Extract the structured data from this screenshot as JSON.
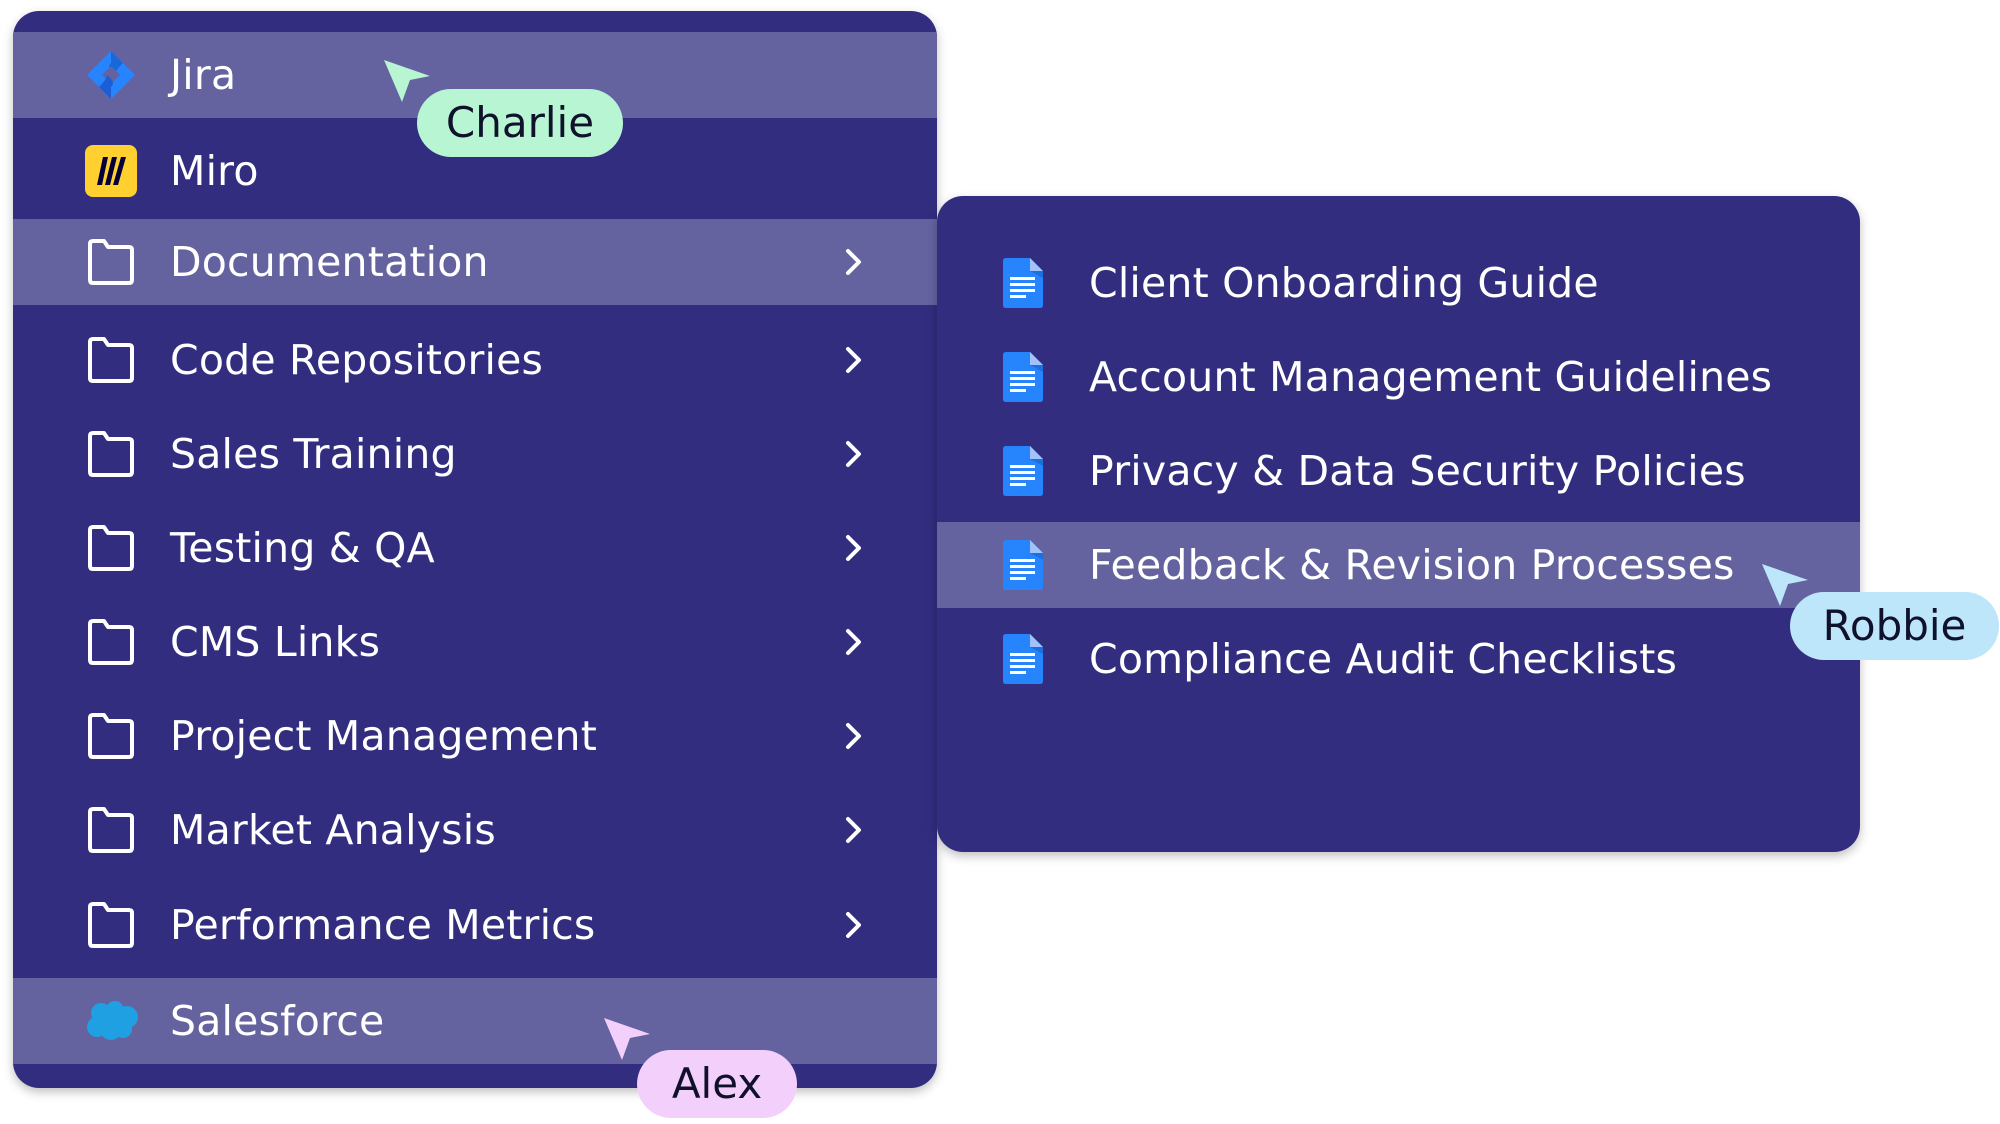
{
  "main_menu": {
    "items": [
      {
        "label": "Jira",
        "icon": "jira-logo-icon",
        "highlighted": true,
        "has_submenu": false
      },
      {
        "label": "Miro",
        "icon": "miro-logo-icon",
        "highlighted": false,
        "has_submenu": false
      },
      {
        "label": "Documentation",
        "icon": "folder-icon",
        "highlighted": true,
        "has_submenu": true
      },
      {
        "label": "Code Repositories",
        "icon": "folder-icon",
        "highlighted": false,
        "has_submenu": true
      },
      {
        "label": "Sales Training",
        "icon": "folder-icon",
        "highlighted": false,
        "has_submenu": true
      },
      {
        "label": "Testing & QA",
        "icon": "folder-icon",
        "highlighted": false,
        "has_submenu": true
      },
      {
        "label": "CMS Links",
        "icon": "folder-icon",
        "highlighted": false,
        "has_submenu": true
      },
      {
        "label": "Project Management",
        "icon": "folder-icon",
        "highlighted": false,
        "has_submenu": true
      },
      {
        "label": "Market Analysis",
        "icon": "folder-icon",
        "highlighted": false,
        "has_submenu": true
      },
      {
        "label": "Performance Metrics",
        "icon": "folder-icon",
        "highlighted": false,
        "has_submenu": true
      },
      {
        "label": "Salesforce",
        "icon": "salesforce-logo-icon",
        "highlighted": true,
        "has_submenu": false
      }
    ]
  },
  "sub_menu": {
    "parent": "Documentation",
    "items": [
      {
        "label": "Client Onboarding Guide",
        "icon": "google-doc-icon",
        "highlighted": false
      },
      {
        "label": "Account Management Guidelines",
        "icon": "google-doc-icon",
        "highlighted": false
      },
      {
        "label": "Privacy & Data Security Policies",
        "icon": "google-doc-icon",
        "highlighted": false
      },
      {
        "label": "Feedback & Revision Processes",
        "icon": "google-doc-icon",
        "highlighted": true
      },
      {
        "label": "Compliance Audit Checklists",
        "icon": "google-doc-icon",
        "highlighted": false
      }
    ]
  },
  "collaborators": [
    {
      "name": "Charlie",
      "color": "#b8f5d2",
      "pointing_at": "Jira"
    },
    {
      "name": "Robbie",
      "color": "#bde6fb",
      "pointing_at": "Feedback & Revision Processes"
    },
    {
      "name": "Alex",
      "color": "#f3d0fb",
      "pointing_at": "Salesforce"
    }
  ],
  "colors": {
    "menu_bg": "#322d7e",
    "highlight_bg": "#6562a0",
    "text": "#ffffff"
  }
}
